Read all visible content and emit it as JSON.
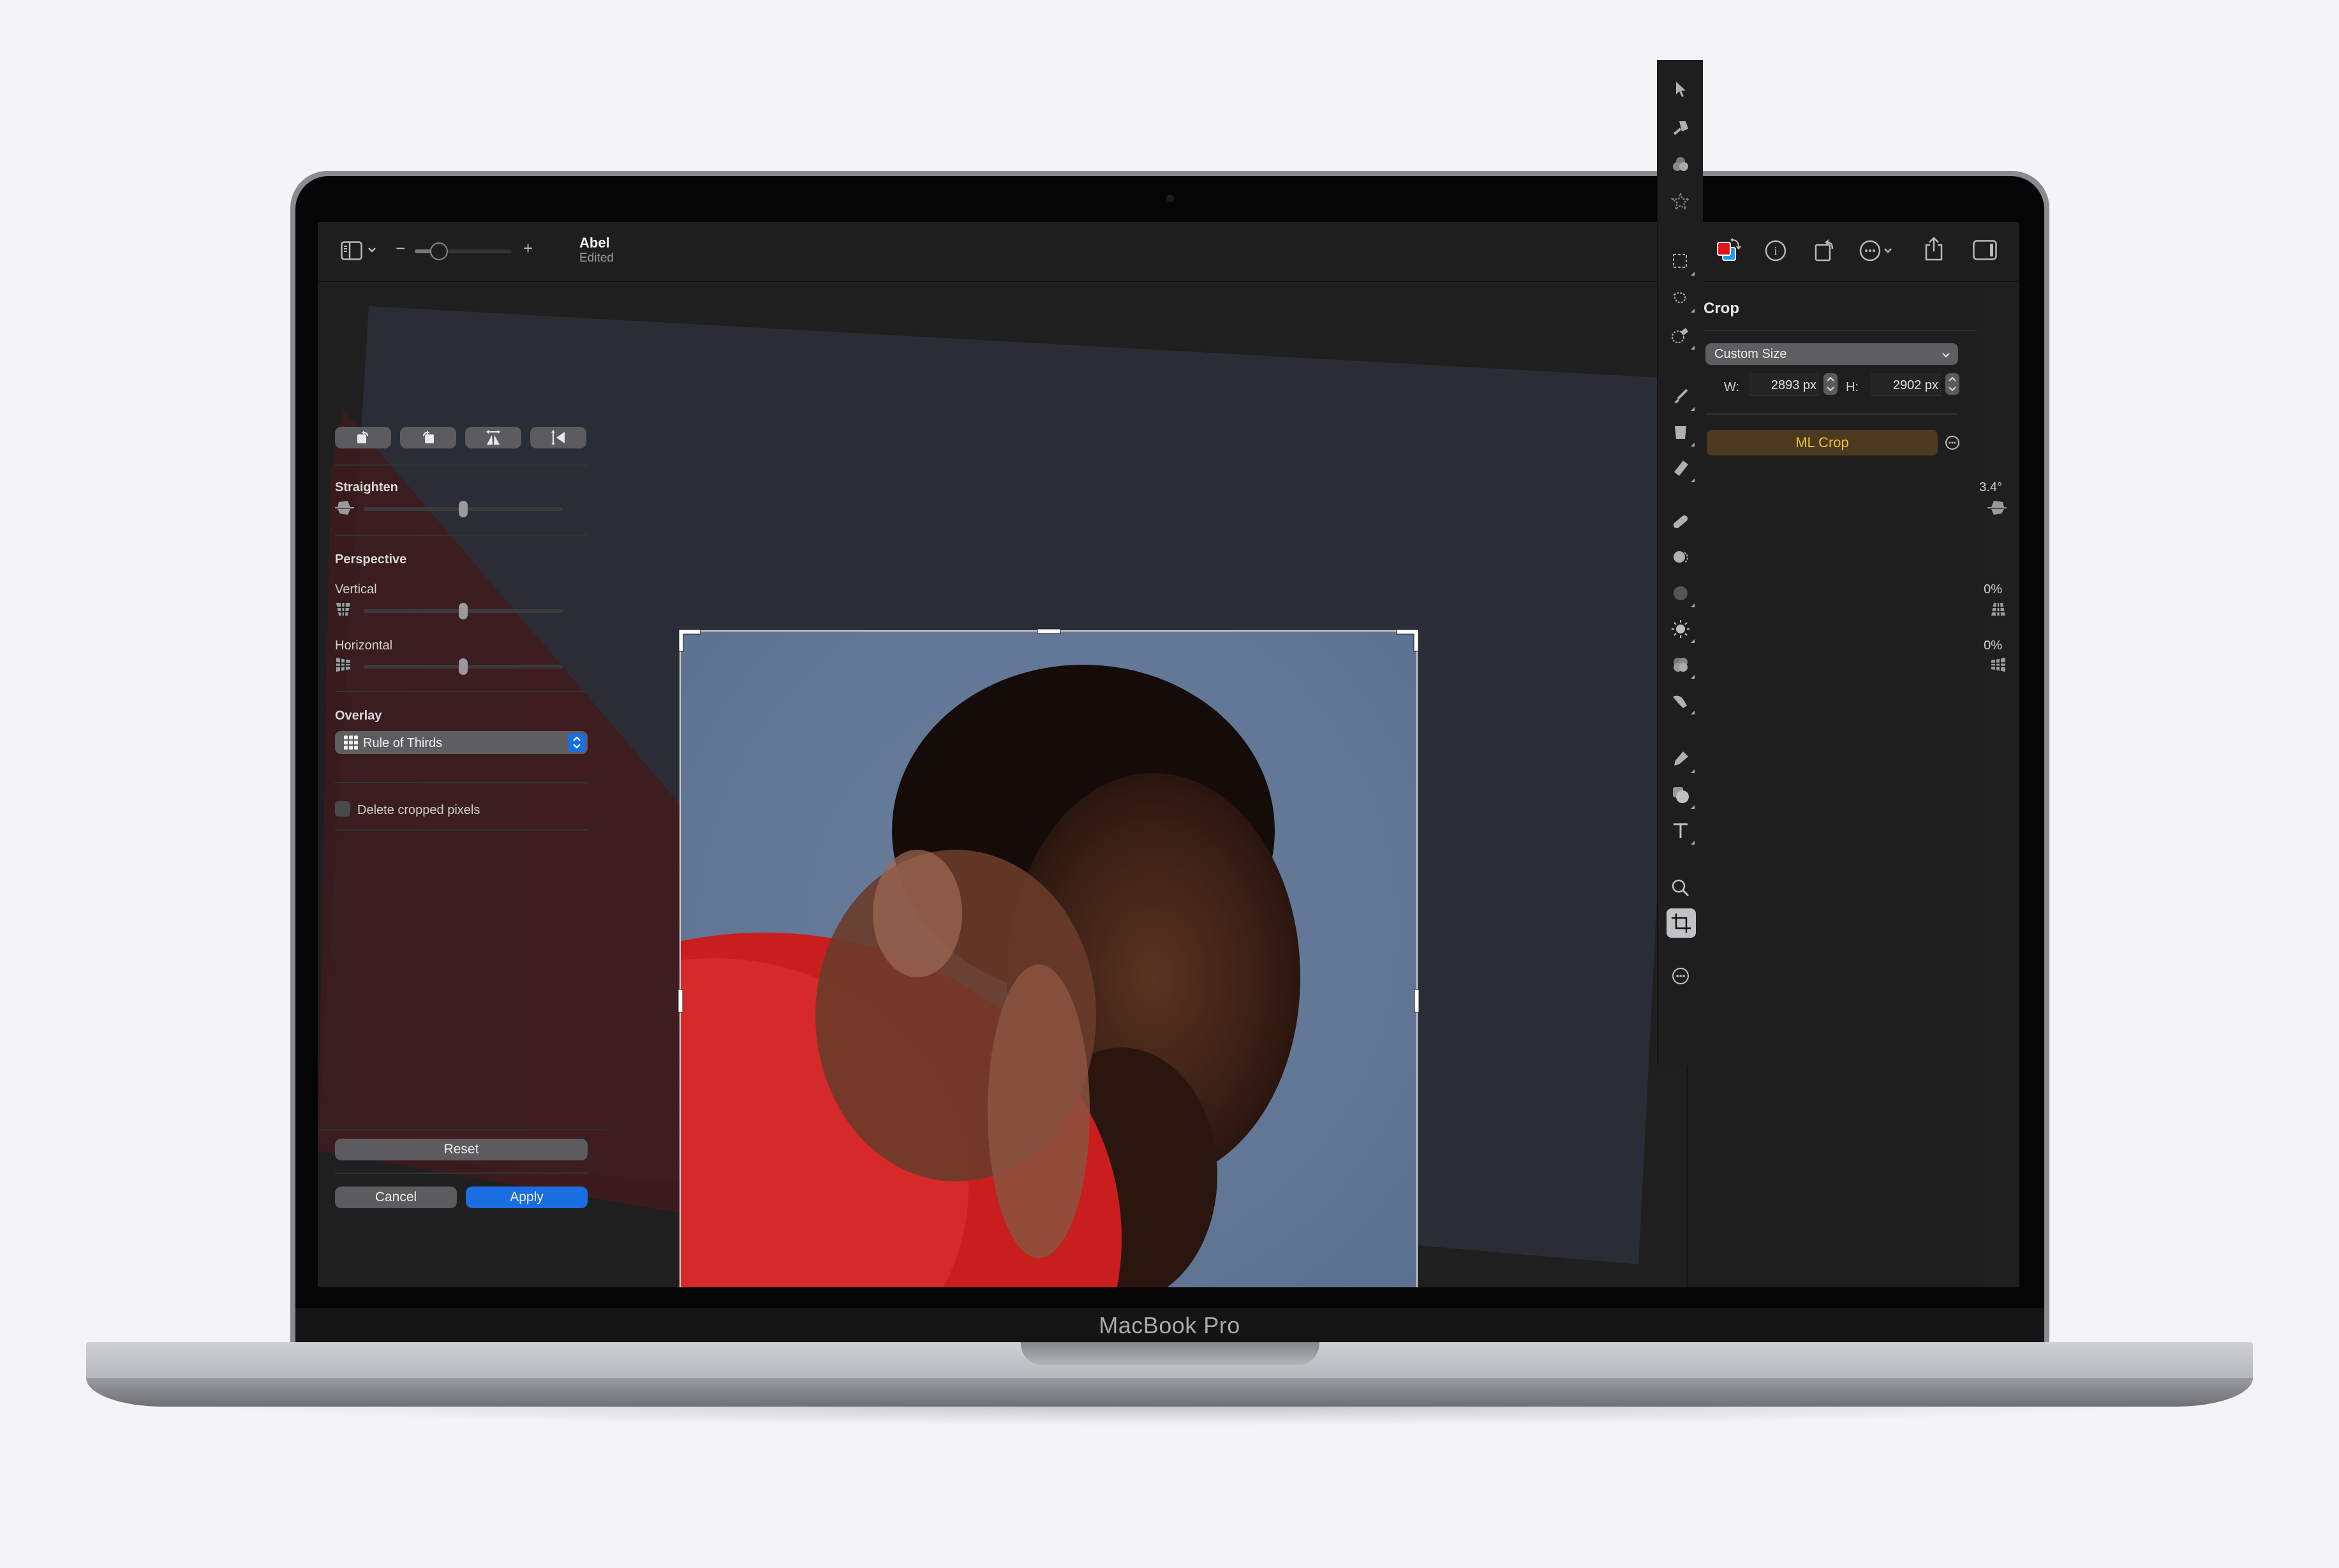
{
  "device": {
    "brand_label": "MacBook Pro"
  },
  "toolbar": {
    "document_title": "Abel",
    "document_status": "Edited",
    "zoom_minus": "−",
    "zoom_plus": "+",
    "zoom_level_fraction": 0.2,
    "left_icons": [
      "sidebar-toggle-icon",
      "chevron-down-icon"
    ],
    "right_icons": [
      "color-swap-icon",
      "info-icon",
      "rotate-icon",
      "more-icon",
      "share-icon",
      "inspector-toggle-icon"
    ]
  },
  "panel": {
    "title": "Crop",
    "size_preset": "Custom Size",
    "width_label": "W:",
    "width_value": "2893 px",
    "height_label": "H:",
    "height_value": "2902 px",
    "ml_crop_label": "ML Crop",
    "transform_buttons": [
      "rotate-left",
      "rotate-right",
      "flip-horizontal",
      "flip-vertical"
    ],
    "straighten": {
      "label": "Straighten",
      "value": "3.4°",
      "position": 0.5
    },
    "perspective": {
      "label": "Perspective",
      "vertical": {
        "label": "Vertical",
        "value": "0%",
        "position": 0.5
      },
      "horizontal": {
        "label": "Horizontal",
        "value": "0%",
        "position": 0.5
      }
    },
    "overlay": {
      "label": "Overlay",
      "selected": "Rule of Thirds"
    },
    "delete_cropped": {
      "label": "Delete cropped pixels",
      "checked": false
    },
    "reset_label": "Reset",
    "cancel_label": "Cancel",
    "apply_label": "Apply"
  },
  "tools": [
    "arrow-pointer-icon",
    "paint-brush-style-icon",
    "color-adjust-icon",
    "effects-star-icon",
    "rect-select-icon",
    "lasso-select-icon",
    "magic-select-icon",
    "brush-icon",
    "paint-bucket-icon",
    "eraser-icon",
    "bandage-icon",
    "clone-icon",
    "noise-icon",
    "light-icon",
    "color-blend-icon",
    "smudge-icon",
    "pen-icon",
    "shape-icon",
    "text-icon",
    "zoom-icon",
    "crop-icon",
    "more-tools-icon"
  ],
  "colors": {
    "accent_blue": "#1a6ee0",
    "ml_crop_bg": "#4a3a1f",
    "ml_crop_text": "#f0c030"
  }
}
